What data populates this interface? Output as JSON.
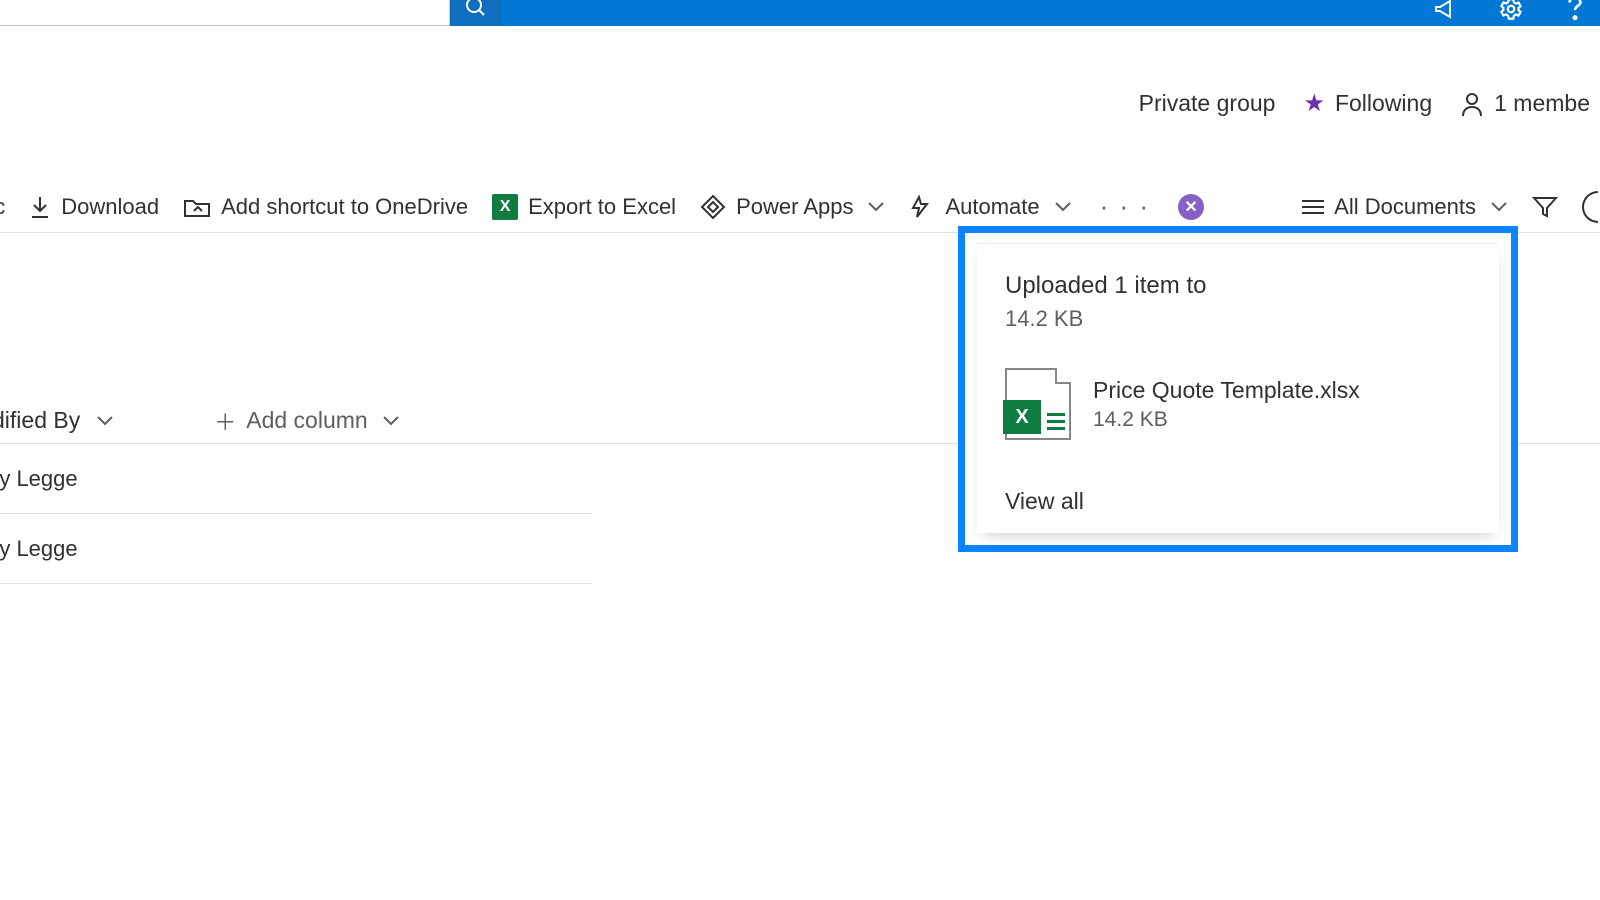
{
  "colors": {
    "brand": "#0078d4",
    "excel": "#107c41"
  },
  "topbar": {
    "search_placeholder": ""
  },
  "header": {
    "privacy": "Private group",
    "following": "Following",
    "members": "1 membe"
  },
  "cmdbar": {
    "partial_left": "nc",
    "download": "Download",
    "add_shortcut": "Add shortcut to OneDrive",
    "export_excel": "Export to Excel",
    "power_apps": "Power Apps",
    "automate": "Automate",
    "view_name": "All Documents"
  },
  "columns": {
    "modified_by_partial": "dified By",
    "add_column": "Add column"
  },
  "rows": [
    {
      "modified_by_partial": "ry Legge"
    },
    {
      "modified_by_partial": "ry Legge"
    }
  ],
  "toast": {
    "title": "Uploaded 1 item to",
    "total_size": "14.2 KB",
    "file_name": "Price Quote Template.xlsx",
    "file_size": "14.2 KB",
    "view_all": "View all"
  }
}
